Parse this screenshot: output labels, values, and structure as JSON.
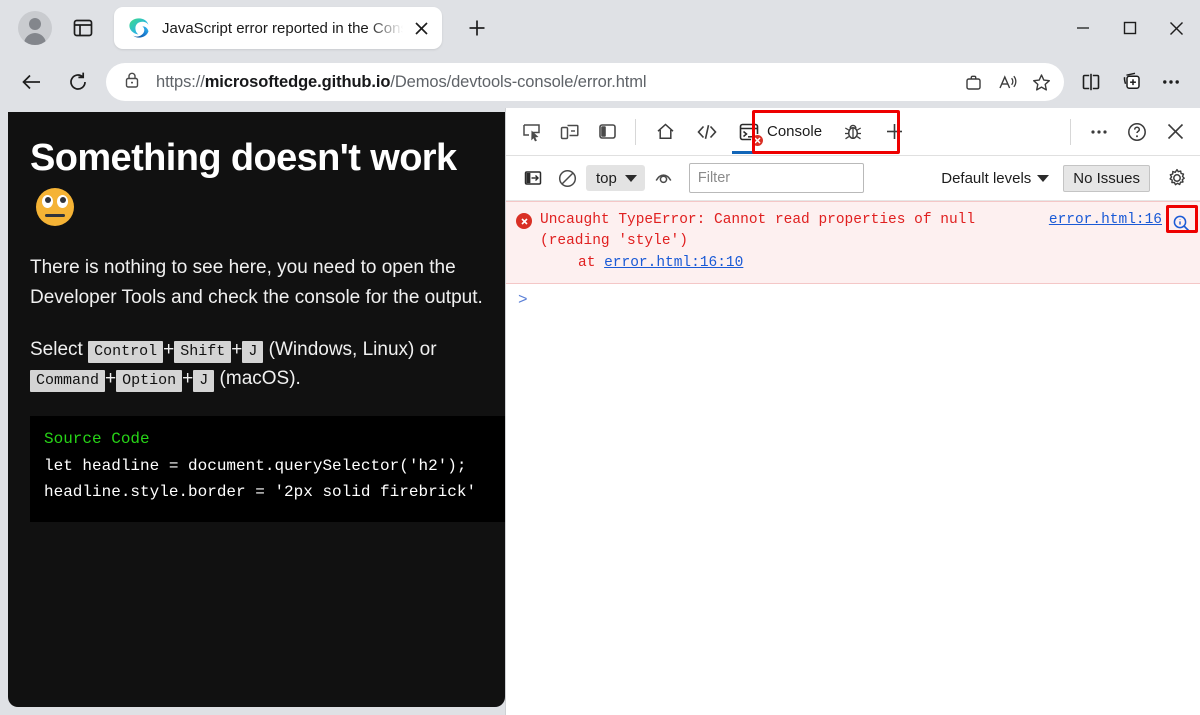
{
  "browser": {
    "profile_icon": "account-avatar-icon",
    "tab_search_icon": "tab-manager-icon",
    "tab": {
      "title": "JavaScript error reported in the Console",
      "favicon": "edge-logo-icon",
      "close_icon": "close-icon"
    },
    "new_tab_icon": "plus-icon",
    "window_controls": {
      "minimize": "minimize-icon",
      "maximize": "maximize-icon",
      "close": "close-icon"
    },
    "nav": {
      "back_icon": "back-arrow-icon",
      "reload_icon": "reload-icon"
    },
    "omnibox": {
      "lock_icon": "lock-icon",
      "url_scheme": "https://",
      "url_host": "microsoftedge.github.io",
      "url_path": "/Demos/devtools-console/error.html",
      "full_url": "https://microsoftedge.github.io/Demos/devtools-console/error.html",
      "collections_icon": "briefcase-icon",
      "read_aloud_icon": "read-aloud-icon",
      "favorite_icon": "star-icon"
    },
    "toolbar": {
      "split_screen_icon": "split-screen-icon",
      "add_collection_icon": "add-to-collections-icon",
      "settings_more_icon": "more-options-icon"
    }
  },
  "page": {
    "heading": "Something doesn't work",
    "heading_emoji": "face-with-rolling-eyes-emoji",
    "paragraph": "There is nothing to see here, you need to open the Developer Tools and check the console for the output.",
    "shortcut": {
      "prefix": "Select",
      "win_keys": [
        "Control",
        "Shift",
        "J"
      ],
      "win_label": "(Windows, Linux) or",
      "mac_keys": [
        "Command",
        "Option",
        "J"
      ],
      "mac_label": "(macOS)."
    },
    "code": {
      "title": "Source Code",
      "lines": [
        "let headline = document.querySelector('h2');",
        "headline.style.border = '2px solid firebrick'"
      ]
    }
  },
  "devtools": {
    "tools": {
      "inspect_icon": "inspect-element-icon",
      "device_emulation_icon": "device-emulation-icon",
      "dock_side_icon": "dock-side-icon",
      "welcome_icon": "home-icon",
      "elements_icon": "elements-code-icon",
      "console_tab_label": "Console",
      "console_tab_icon": "console-terminal-icon",
      "console_error_badge": "error-badge-icon",
      "debugger_icon": "debugger-bug-icon",
      "more_tabs_icon": "plus-icon",
      "more_tools_icon": "more-tools-icon",
      "help_icon": "help-icon",
      "close_devtools_icon": "close-icon"
    },
    "filterbar": {
      "sidebar_toggle_icon": "console-sidebar-toggle-icon",
      "clear_console_icon": "clear-console-icon",
      "context_selector": "top",
      "live_expression_icon": "eye-icon",
      "filter_placeholder": "Filter",
      "filter_value": "",
      "levels_label": "Default levels",
      "issues_label": "No Issues",
      "settings_icon": "gear-icon"
    },
    "console": {
      "error_message": "Uncaught TypeError: Cannot read properties of null (reading 'style')",
      "error_stack_prefix": "at",
      "error_stack_link": "error.html:16:10",
      "error_source_link": "error.html:16",
      "search_icon": "search-magnifier-icon",
      "prompt": ">"
    }
  },
  "annotations": {
    "console_tab_highlight": "red-box-around-console-tab",
    "search_icon_highlight": "red-box-around-search-icon",
    "highlight_color": "#ee0000"
  }
}
